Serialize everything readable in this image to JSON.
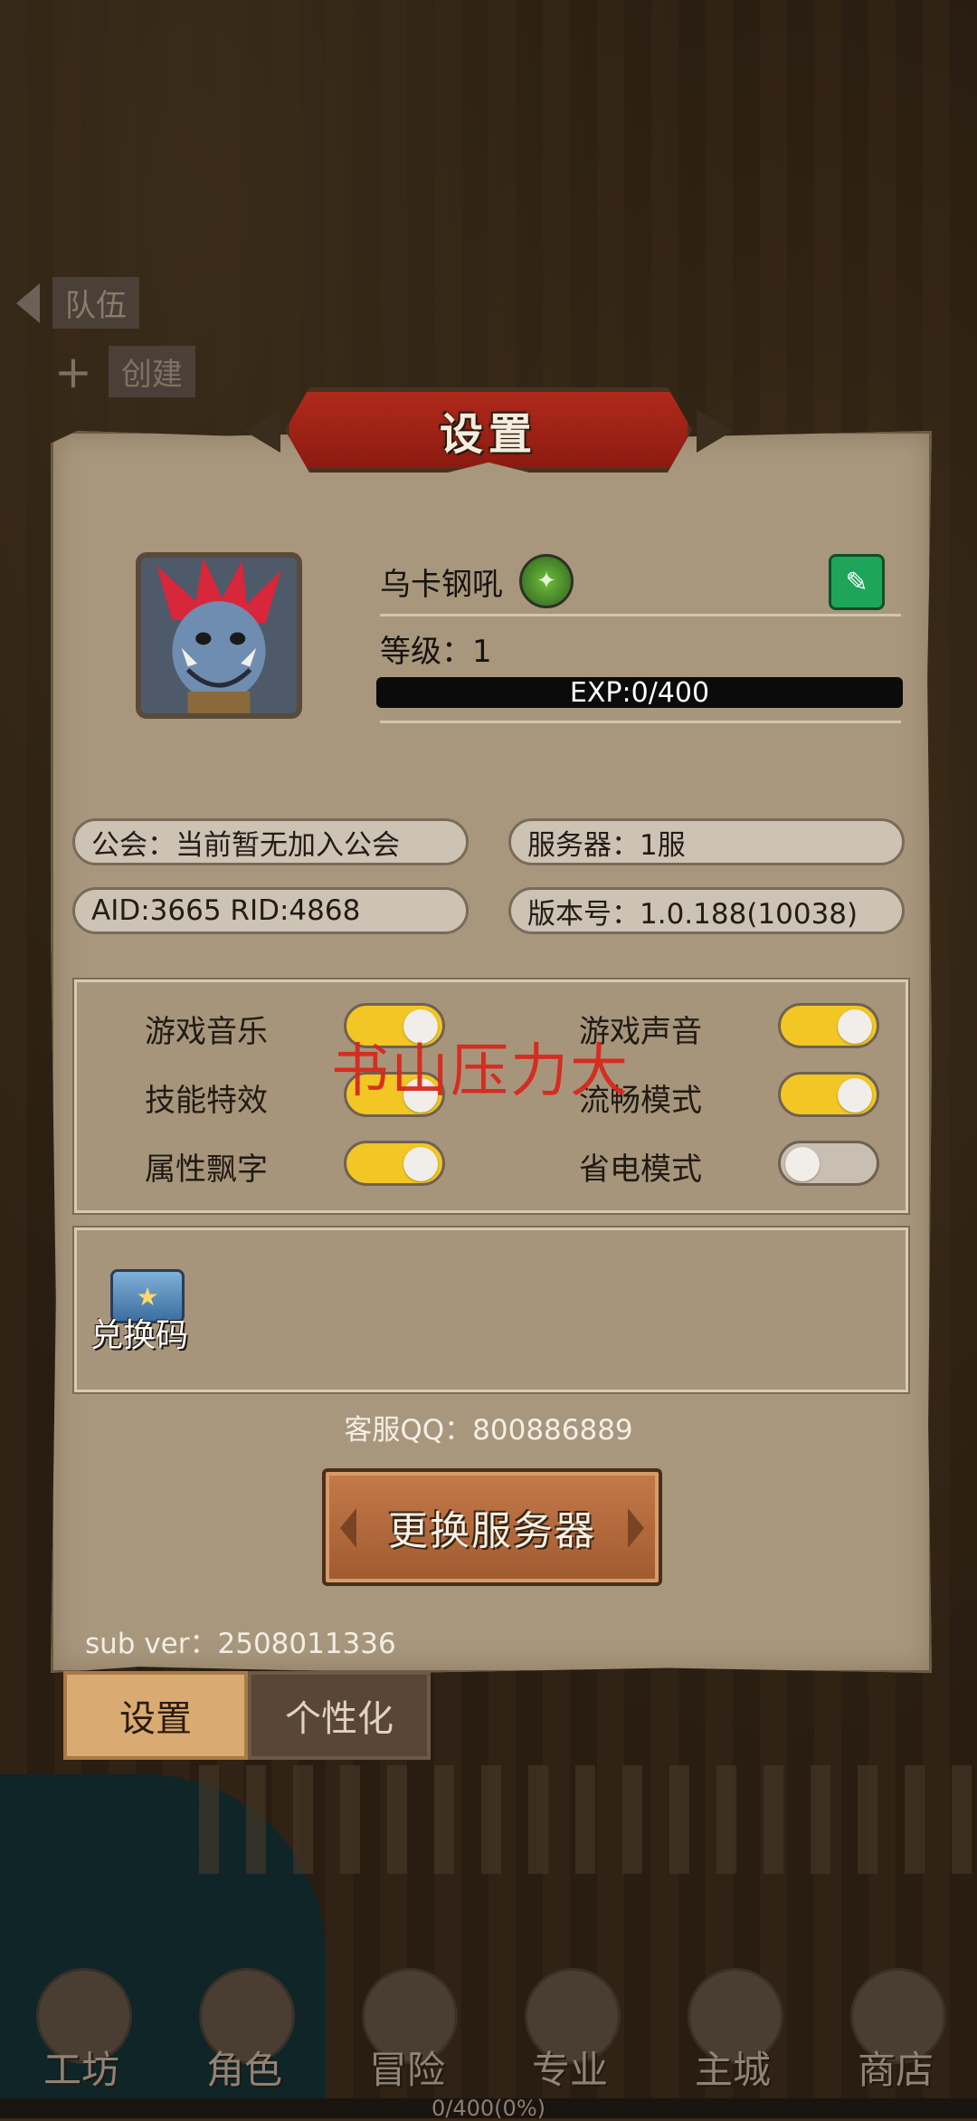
{
  "background": {
    "team_label": "队伍",
    "create_label": "创建"
  },
  "panel": {
    "title": "设置",
    "profile": {
      "name": "乌卡钢吼",
      "level_text": "等级：1",
      "exp_text": "EXP:0/400",
      "exp_fraction": 0
    },
    "info": {
      "guild": "公会：当前暂无加入公会",
      "server": "服务器：1服",
      "ids": "AID:3665   RID:4868",
      "version": "版本号：1.0.188(10038)"
    },
    "toggles": [
      {
        "label": "游戏音乐",
        "on": true
      },
      {
        "label": "游戏声音",
        "on": true
      },
      {
        "label": "技能特效",
        "on": true
      },
      {
        "label": "流畅模式",
        "on": true
      },
      {
        "label": "属性飘字",
        "on": true
      },
      {
        "label": "省电模式",
        "on": false
      }
    ],
    "watermark": "书山压力大",
    "redeem_label": "兑换码",
    "qq_text": "客服QQ：800886889",
    "change_server_label": "更换服务器",
    "sub_ver": "sub ver：2508011336"
  },
  "tabs": {
    "settings": "设置",
    "personalize": "个性化"
  },
  "bottom_nav": [
    {
      "label": "工坊",
      "icon": "workshop-icon"
    },
    {
      "label": "角色",
      "icon": "character-icon"
    },
    {
      "label": "冒险",
      "icon": "adventure-icon"
    },
    {
      "label": "专业",
      "icon": "profession-icon"
    },
    {
      "label": "主城",
      "icon": "main-city-icon"
    },
    {
      "label": "商店",
      "icon": "shop-icon"
    }
  ],
  "bottom_exp": "0/400(0%)",
  "colors": {
    "toggle_on": "#f2c624",
    "toggle_off": "#c8beb2",
    "banner_red": "#b02a1c",
    "edit_green": "#1ea55a"
  }
}
